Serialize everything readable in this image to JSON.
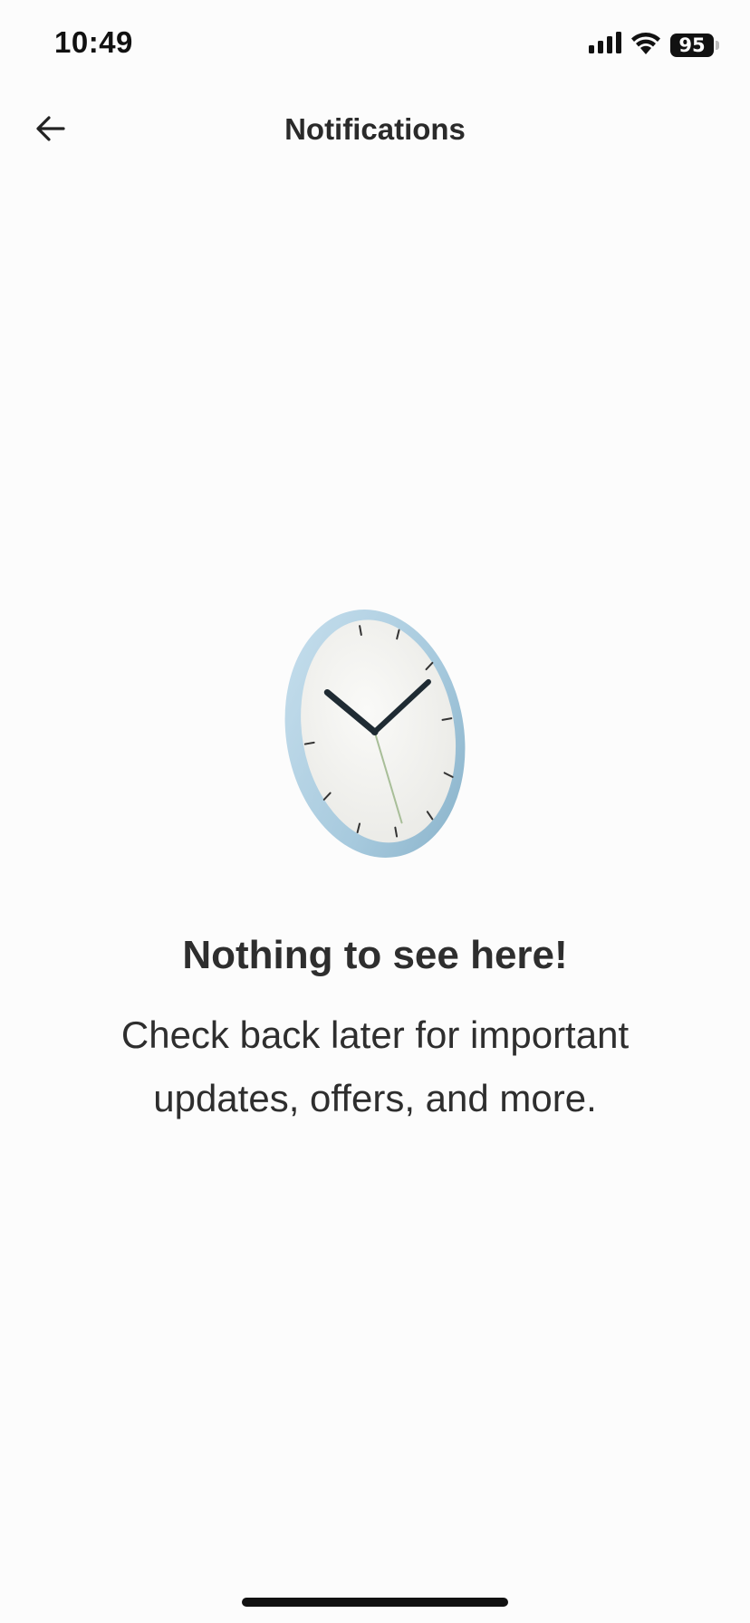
{
  "status_bar": {
    "time": "10:49",
    "battery": "95",
    "icons": [
      "cellular-signal-icon",
      "wifi-icon",
      "battery-icon"
    ]
  },
  "nav": {
    "title": "Notifications",
    "back_icon": "arrow-left-icon"
  },
  "empty_state": {
    "illustration": "wall-clock-illustration",
    "heading": "Nothing to see here!",
    "message": "Check back later for important updates, offers, and more."
  },
  "colors": {
    "background": "#FCFCFC",
    "text": "#2E2E2E",
    "clock_rim": "#A9CCE0",
    "clock_face": "#F1F1EE"
  }
}
